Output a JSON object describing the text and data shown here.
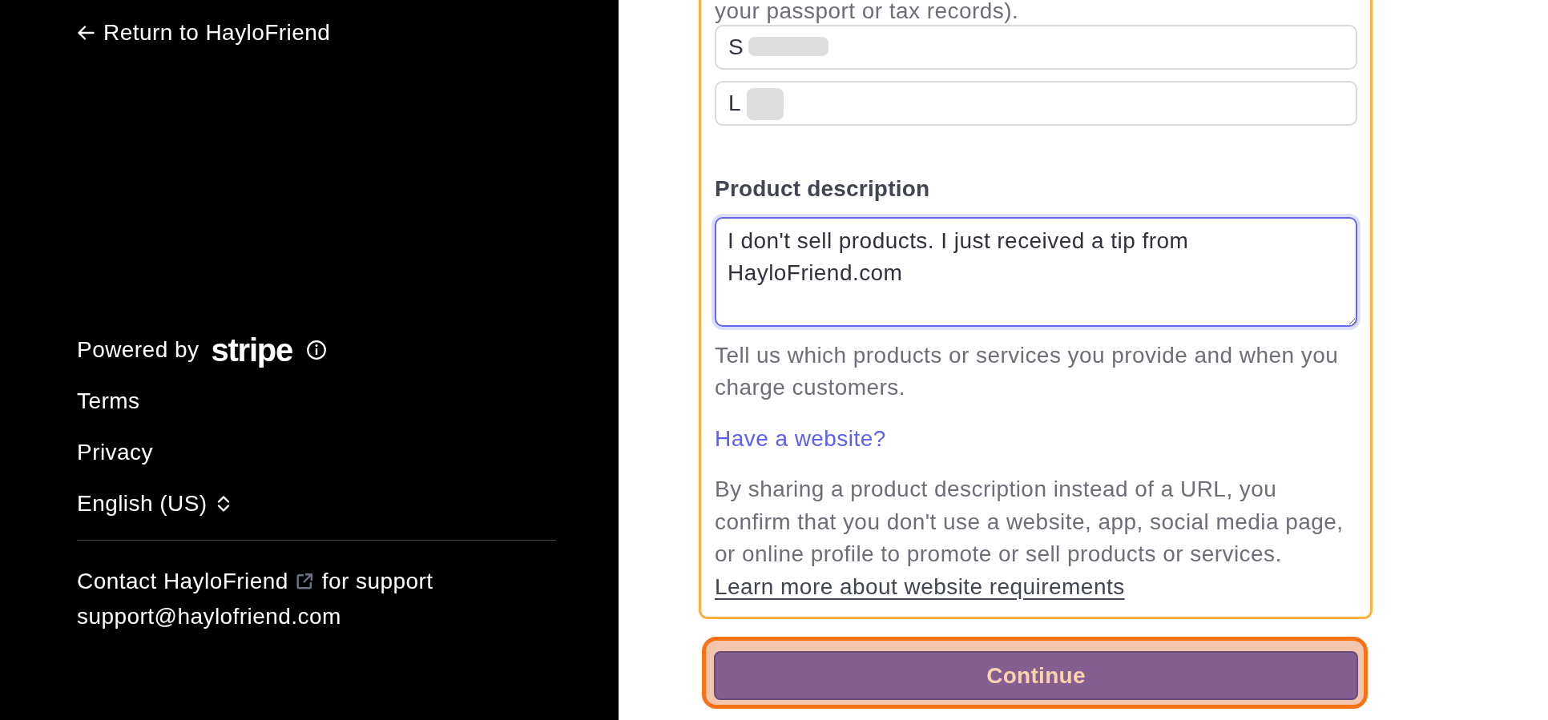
{
  "sidebar": {
    "back_link": "Return to HayloFriend",
    "powered_by": "Powered by",
    "logo": "stripe",
    "links": [
      "Terms",
      "Privacy"
    ],
    "language": "English (US)",
    "contact": {
      "link": "Contact HayloFriend",
      "suffix": "for support"
    },
    "email": "support@haylofriend.com"
  },
  "form": {
    "intro_tail": "your passport or tax records).",
    "name_fields": [
      {
        "value": "S",
        "redacted": true
      },
      {
        "value": "L",
        "redacted": true
      }
    ],
    "product_description": {
      "label": "Product description",
      "value": "I don't sell products. I just received a tip from\nHayloFriend.com",
      "focused": true,
      "help": "Tell us which products or services you provide and when you charge customers."
    },
    "website_link": "Have a website?",
    "disclaimer": "By sharing a product description instead of a URL, you confirm that you don't use a website, app, social media page, or online profile to promote or sell products or services.",
    "disclaimer_link": "Learn more about website requirements"
  },
  "continue_button": {
    "label": "Continue"
  }
}
